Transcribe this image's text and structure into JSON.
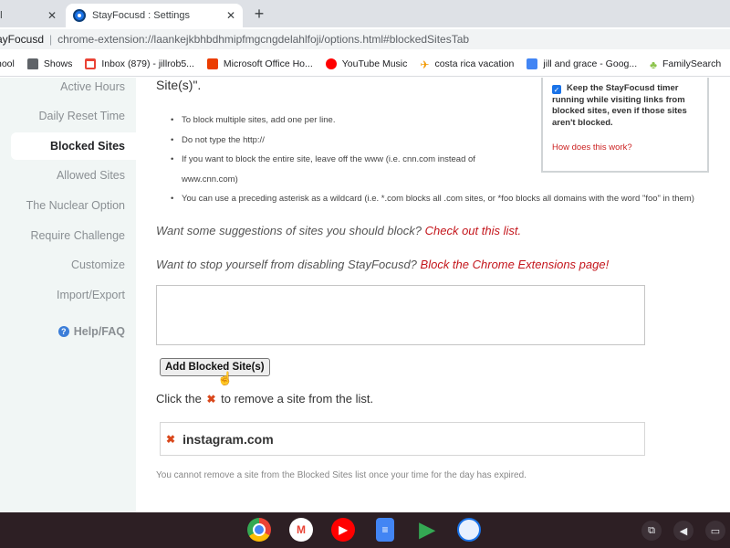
{
  "browser": {
    "prev_tab": {
      "title": "ol"
    },
    "active_tab": {
      "title": "StayFocusd : Settings"
    },
    "omnibox": {
      "host": "ayFocusd",
      "url": "chrome-extension://laankejkbhbdhmipfmgcngdelahlfoji/options.html#blockedSitesTab"
    },
    "bookmarks": [
      {
        "label": "hool",
        "icon": "page-icon"
      },
      {
        "label": "Shows",
        "icon": "folder-icon"
      },
      {
        "label": "Inbox (879) - jillrob5...",
        "icon": "gmail-icon"
      },
      {
        "label": "Microsoft Office Ho...",
        "icon": "office-icon"
      },
      {
        "label": "YouTube Music",
        "icon": "youtube-music-icon"
      },
      {
        "label": "costa rica vacation",
        "icon": "plane-icon"
      },
      {
        "label": "jill and grace - Goog...",
        "icon": "docs-icon"
      },
      {
        "label": "FamilySearch",
        "icon": "familysearch-icon"
      }
    ]
  },
  "sidebar": {
    "items": [
      {
        "label": "Active Hours"
      },
      {
        "label": "Daily Reset Time"
      },
      {
        "label": "Blocked Sites"
      },
      {
        "label": "Allowed Sites"
      },
      {
        "label": "The Nuclear Option"
      },
      {
        "label": "Require Challenge"
      },
      {
        "label": "Customize"
      },
      {
        "label": "Import/Export"
      }
    ],
    "help": "Help/FAQ"
  },
  "main": {
    "heading_tail": "Site(s)\".",
    "bullets": [
      "To block multiple sites, add one per line.",
      "Do not type the http://",
      "If you want to block the entire site, leave off the www (i.e. cnn.com instead of www.cnn.com)",
      "You can use a preceding asterisk as a wildcard (i.e. *.com blocks all .com sites, or *foo blocks all domains with the word \"foo\" in them)"
    ],
    "stayer": {
      "text": "Keep the StayFocusd timer running while visiting links from blocked sites, even if those sites aren't blocked.",
      "link": "How does this work?"
    },
    "suggest_text": "Want some suggestions of sites you should block?",
    "suggest_link": "Check out this list.",
    "disable_text": "Want to stop yourself from disabling StayFocusd?",
    "disable_link": "Block the Chrome Extensions page",
    "disable_end": "!",
    "add_button": "Add Blocked Site(s)",
    "click_pre": "Click the",
    "click_post": "to remove a site from the list.",
    "blocked_sites": [
      "instagram.com"
    ],
    "expired_note": "You cannot remove a site from the Blocked Sites list once your time for the day has expired."
  },
  "shelf": {
    "apps": [
      "chrome-icon",
      "gmail-icon",
      "youtube-icon",
      "docs-icon",
      "play-store-icon",
      "stayfocusd-icon"
    ]
  }
}
